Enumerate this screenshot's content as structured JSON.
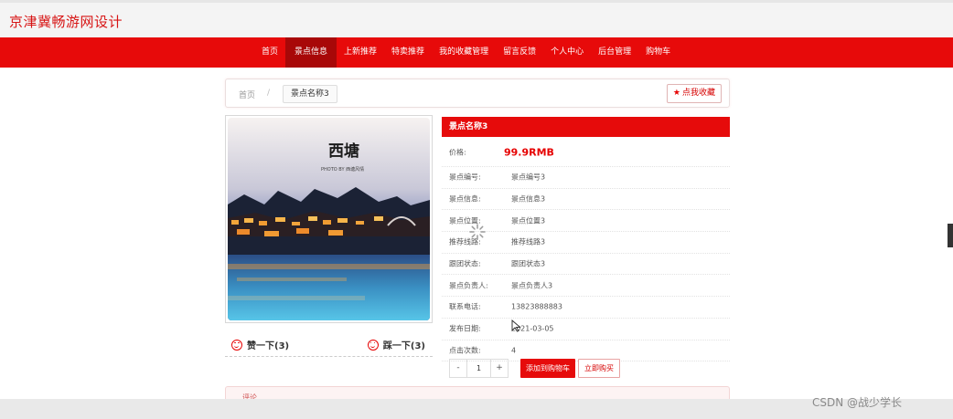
{
  "header": {
    "site_title": "京津冀畅游网设计"
  },
  "nav": {
    "items": [
      "首页",
      "景点信息",
      "上新推荐",
      "特卖推荐",
      "我的收藏管理",
      "留言反馈",
      "个人中心",
      "后台管理",
      "购物车"
    ],
    "active_index": 1
  },
  "breadcrumb": {
    "home": "首页",
    "separator": "/",
    "current": "景点名称3",
    "favorite_label": "点我收藏"
  },
  "image": {
    "caption_main": "西塘",
    "caption_sub": "PHOTO BY 西塘风情"
  },
  "votes": {
    "up": "赞一下(3)",
    "down": "踩一下(3)"
  },
  "detail": {
    "title": "景点名称3",
    "price_label": "价格:",
    "price": "99.9RMB",
    "rows": [
      {
        "label": "景点编号:",
        "value": "景点编号3"
      },
      {
        "label": "景点信息:",
        "value": "景点信息3"
      },
      {
        "label": "景点位置:",
        "value": "景点位置3"
      },
      {
        "label": "推荐线路:",
        "value": "推荐线路3"
      },
      {
        "label": "跟团状态:",
        "value": "跟团状态3"
      },
      {
        "label": "景点负责人:",
        "value": "景点负责人3"
      },
      {
        "label": "联系电话:",
        "value": "13823888883"
      },
      {
        "label": "发布日期:",
        "value": "2021-03-05"
      },
      {
        "label": "点击次数:",
        "value": "4"
      }
    ]
  },
  "purchase": {
    "minus": "-",
    "quantity": "1",
    "plus": "+",
    "add_cart": "添加到购物车",
    "buy_now": "立即购买"
  },
  "comments": {
    "title": "评论"
  },
  "watermark": "CSDN @战少学长",
  "colors": {
    "brand_red": "#e60b0b",
    "active_nav": "#a80808",
    "price_red": "#e60000"
  },
  "icons": [
    "star-icon",
    "smile-icon",
    "loading-icon",
    "cursor-icon"
  ]
}
